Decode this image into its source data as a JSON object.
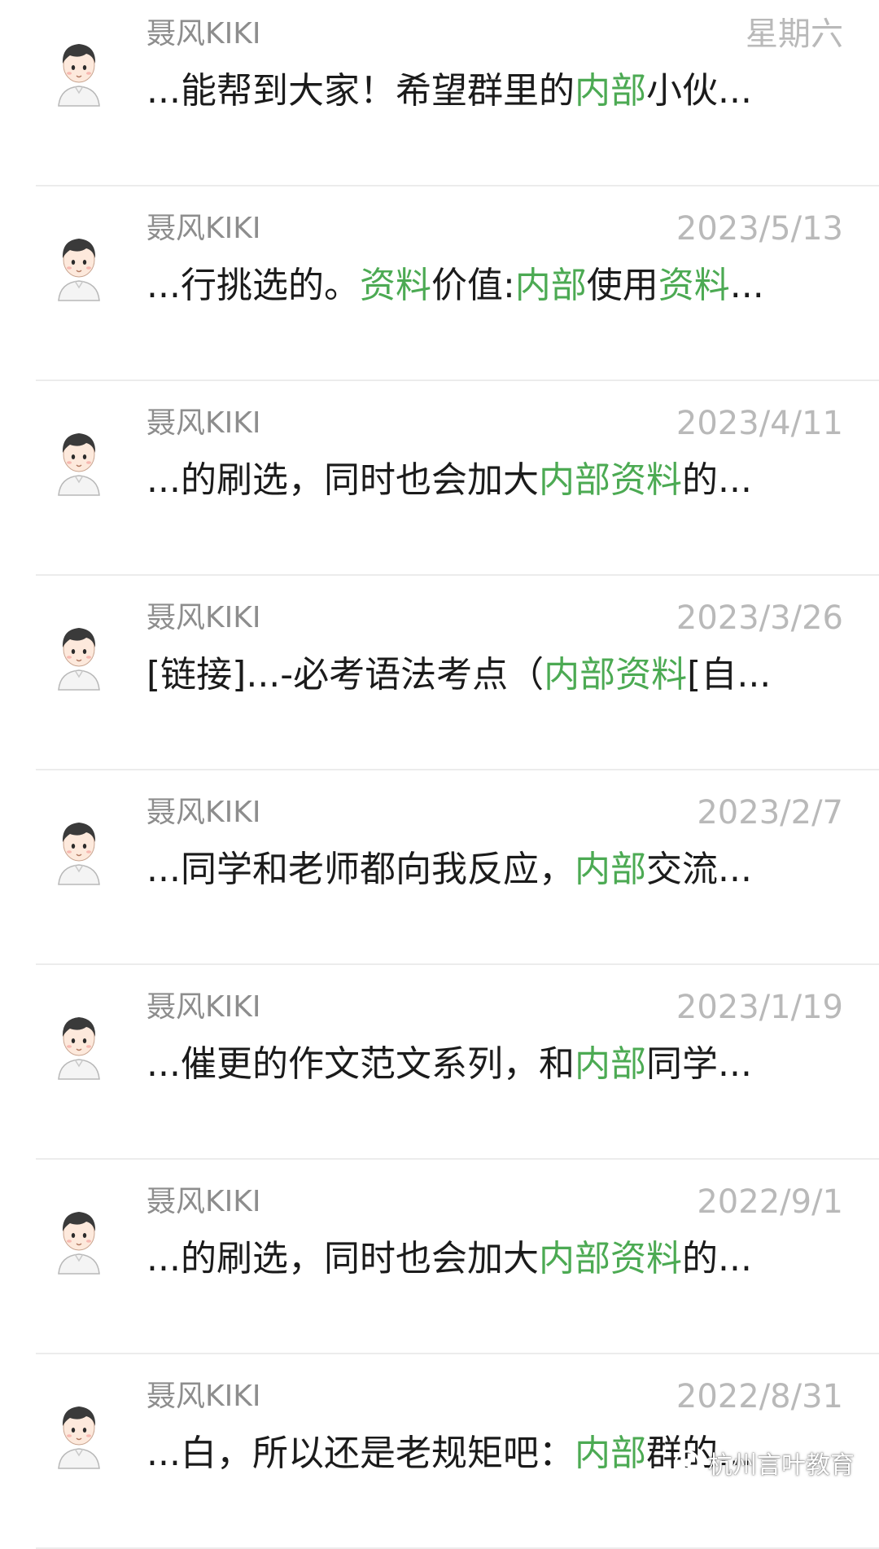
{
  "colors": {
    "highlight": "#4caa53",
    "name": "#8d8d8d",
    "date": "#b9b9b9",
    "text": "#1b1b1b",
    "divider": "#ececec"
  },
  "rows": [
    {
      "name": "聂风KIKI",
      "date": "星期六",
      "snippet": [
        {
          "t": "...能帮到大家！希望群里的",
          "h": false
        },
        {
          "t": "内部",
          "h": true
        },
        {
          "t": "小伙...",
          "h": false
        }
      ]
    },
    {
      "name": "聂风KIKI",
      "date": "2023/5/13",
      "snippet": [
        {
          "t": "...行挑选的。",
          "h": false
        },
        {
          "t": "资料",
          "h": true
        },
        {
          "t": "价值:",
          "h": false
        },
        {
          "t": "内部",
          "h": true
        },
        {
          "t": "使用",
          "h": false
        },
        {
          "t": "资料",
          "h": true
        },
        {
          "t": "...",
          "h": false
        }
      ]
    },
    {
      "name": "聂风KIKI",
      "date": "2023/4/11",
      "snippet": [
        {
          "t": "...的刷选，同时也会加大",
          "h": false
        },
        {
          "t": "内部资料",
          "h": true
        },
        {
          "t": "的...",
          "h": false
        }
      ]
    },
    {
      "name": "聂风KIKI",
      "date": "2023/3/26",
      "snippet": [
        {
          "t": "[链接]...-必考语法考点（",
          "h": false
        },
        {
          "t": "内部资料",
          "h": true
        },
        {
          "t": "[自...",
          "h": false
        }
      ]
    },
    {
      "name": "聂风KIKI",
      "date": "2023/2/7",
      "snippet": [
        {
          "t": "...同学和老师都向我反应，",
          "h": false
        },
        {
          "t": "内部",
          "h": true
        },
        {
          "t": "交流...",
          "h": false
        }
      ]
    },
    {
      "name": "聂风KIKI",
      "date": "2023/1/19",
      "snippet": [
        {
          "t": "...催更的作文范文系列，和",
          "h": false
        },
        {
          "t": "内部",
          "h": true
        },
        {
          "t": "同学...",
          "h": false
        }
      ]
    },
    {
      "name": "聂风KIKI",
      "date": "2022/9/1",
      "snippet": [
        {
          "t": "...的刷选，同时也会加大",
          "h": false
        },
        {
          "t": "内部资料",
          "h": true
        },
        {
          "t": "的...",
          "h": false
        }
      ]
    },
    {
      "name": "聂风KIKI",
      "date": "2022/8/31",
      "snippet": [
        {
          "t": "...白，所以还是老规矩吧：",
          "h": false
        },
        {
          "t": "内部",
          "h": true
        },
        {
          "t": "群的...",
          "h": false
        }
      ]
    }
  ],
  "watermark": {
    "icon": "wechat-official-account-icon",
    "text": "杭州言叶教育"
  }
}
